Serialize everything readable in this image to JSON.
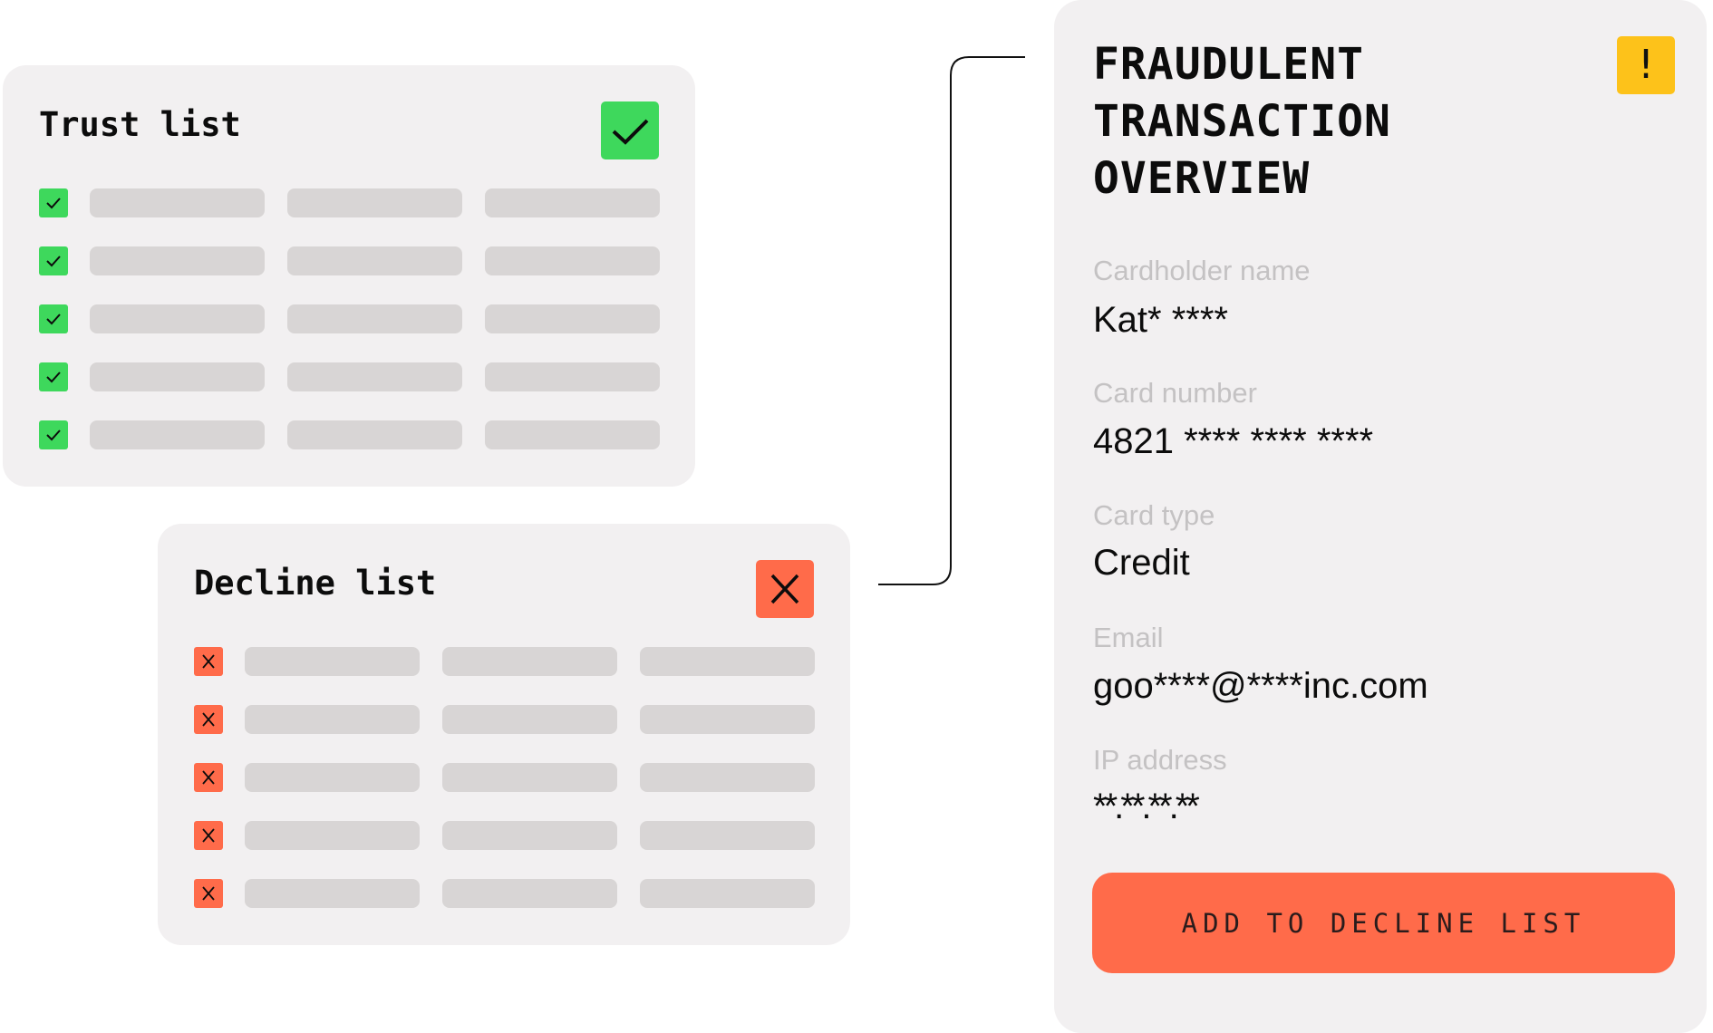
{
  "trust_list": {
    "title": "Trust list",
    "status_icon": "check-icon",
    "row_count": 5,
    "columns_per_row": 3,
    "accent_color": "#3ed85c"
  },
  "decline_list": {
    "title": "Decline list",
    "status_icon": "x-icon",
    "row_count": 5,
    "columns_per_row": 3,
    "accent_color": "#ff6b4a"
  },
  "overview": {
    "title": "FRAUDULENT\nTRANSACTION\nOVERVIEW",
    "warning_icon": "exclamation-icon",
    "warning_glyph": "!",
    "warning_color": "#fdc21a",
    "fields": [
      {
        "label": "Cardholder name",
        "value": "Kat* ****"
      },
      {
        "label": "Card number",
        "value": "4821 **** **** ****"
      },
      {
        "label": "Card type",
        "value": "Credit"
      },
      {
        "label": "Email",
        "value": "goo****@****inc.com"
      },
      {
        "label": "IP address",
        "value": "**.**.**.**"
      }
    ],
    "action_button": "ADD TO DECLINE LIST"
  }
}
